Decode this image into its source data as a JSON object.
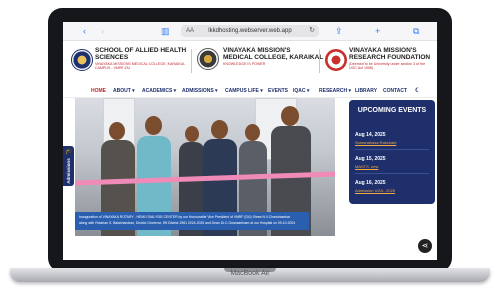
{
  "device": {
    "label": "MacBook Air"
  },
  "browser": {
    "url": "lkkdhosting.webserver.web.app",
    "text_size_label": "AA"
  },
  "header": {
    "org1": {
      "line1": "SCHOOL OF ALLIED HEALTH",
      "line2": "SCIENCES",
      "sub": "VINAYAKA MISSIONS MEDICAL COLLEGE, KARAIKAL CAMPUS - VMRF-DU"
    },
    "org2": {
      "line1": "VINAYAKA MISSION'S",
      "line2": "MEDICAL COLLEGE, KARAIKAL",
      "sub": "KNOWLEDGE IS POWER"
    },
    "org3": {
      "line1": "VINAYAKA MISSION'S",
      "line2": "RESEARCH FOUNDATION",
      "sub": "(Deemed to be University under section 3 of the UGC Act 1956)"
    }
  },
  "nav": {
    "items": [
      "HOME",
      "ABOUT ▾",
      "ACADEMICS ▾",
      "ADMISSIONS ▾",
      "CAMPUS LIFE ▾",
      "EVENTS",
      "IQAC ▾",
      "RESEARCH ▾",
      "LIBRARY",
      "CONTACT"
    ]
  },
  "hero": {
    "caption_line1": "Inauguration of VINAYAKA ROTARY - HEMO DIALYSIS CENTER by our Honourable Vice President of VMRF (DU) Shree.N.V.Chandrasekar",
    "caption_line2": "along with Rotarian S. Balachandran, District Governor, Rtl District 2981 2024-2025 and Dean Dr.C.Gnanaselvam at our Hospital on 09-10-2024"
  },
  "side_tab": {
    "label": "Admissions"
  },
  "events": {
    "title": "UPCOMING EVENTS",
    "items": [
      {
        "date": "Aug 14, 2025",
        "name": "Somanahasa Rakshabi"
      },
      {
        "date": "Aug 15, 2025",
        "name": "MASTS, new"
      },
      {
        "date": "Aug 16, 2025",
        "name": "Admission UG/L, 2025"
      }
    ]
  },
  "colors": {
    "brand_navy": "#1e2f6b",
    "accent_red": "#c0262d",
    "event_link": "#f5a742"
  }
}
